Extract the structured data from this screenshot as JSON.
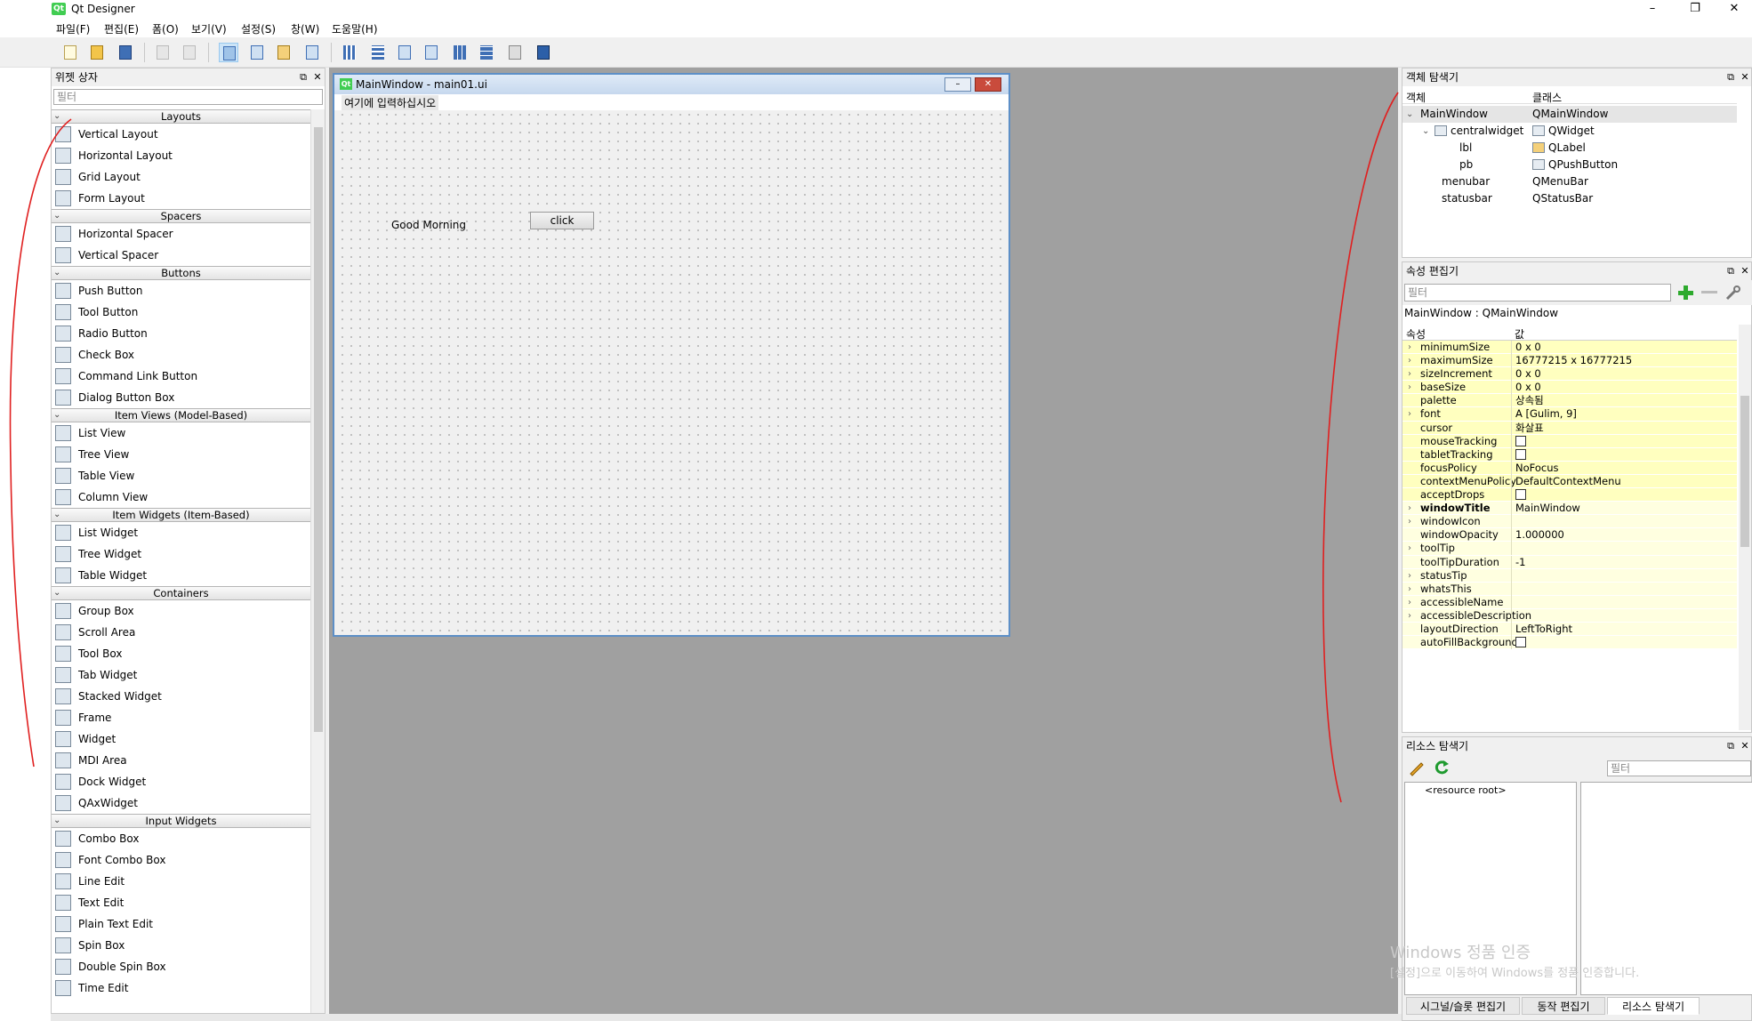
{
  "window": {
    "title": "Qt Designer",
    "logo": "Qt",
    "controls": [
      "–",
      "❐",
      "✕"
    ]
  },
  "menus": [
    "파일(F)",
    "편집(E)",
    "폼(O)",
    "보기(V)",
    "설정(S)",
    "창(W)",
    "도움말(H)"
  ],
  "toolbar_icons": [
    "new-file-icon",
    "open-folder-icon",
    "save-icon",
    "cut-icon",
    "copy-icon",
    "edit-widgets-icon",
    "edit-signals-icon",
    "edit-buddies-icon",
    "edit-taborder-icon",
    "layout-horizontal-icon",
    "layout-vertical-icon",
    "layout-hsplitter-icon",
    "layout-vsplitter-icon",
    "layout-grid-icon",
    "layout-form-icon",
    "break-layout-icon",
    "adjust-size-icon"
  ],
  "widget_box": {
    "title": "위젯 상자",
    "filter_placeholder": "필터",
    "categories": [
      {
        "name": "Layouts",
        "items": [
          "Vertical Layout",
          "Horizontal Layout",
          "Grid Layout",
          "Form Layout"
        ]
      },
      {
        "name": "Spacers",
        "items": [
          "Horizontal Spacer",
          "Vertical Spacer"
        ]
      },
      {
        "name": "Buttons",
        "items": [
          "Push Button",
          "Tool Button",
          "Radio Button",
          "Check Box",
          "Command Link Button",
          "Dialog Button Box"
        ]
      },
      {
        "name": "Item Views (Model-Based)",
        "items": [
          "List View",
          "Tree View",
          "Table View",
          "Column View"
        ]
      },
      {
        "name": "Item Widgets (Item-Based)",
        "items": [
          "List Widget",
          "Tree Widget",
          "Table Widget"
        ]
      },
      {
        "name": "Containers",
        "items": [
          "Group Box",
          "Scroll Area",
          "Tool Box",
          "Tab Widget",
          "Stacked Widget",
          "Frame",
          "Widget",
          "MDI Area",
          "Dock Widget",
          "QAxWidget"
        ]
      },
      {
        "name": "Input Widgets",
        "items": [
          "Combo Box",
          "Font Combo Box",
          "Line Edit",
          "Text Edit",
          "Plain Text Edit",
          "Spin Box",
          "Double Spin Box",
          "Time Edit"
        ]
      }
    ]
  },
  "form_window": {
    "title": "MainWindow - main01.ui",
    "menu_placeholder": "여기에 입력하십시오",
    "label_text": "Good Morning",
    "button_text": "click"
  },
  "object_inspector": {
    "title": "객체 탐색기",
    "col_object": "객체",
    "col_class": "클래스",
    "rows": [
      {
        "name": "MainWindow",
        "class": "QMainWindow"
      },
      {
        "name": "centralwidget",
        "class": "QWidget"
      },
      {
        "name": "lbl",
        "class": "QLabel"
      },
      {
        "name": "pb",
        "class": "QPushButton"
      },
      {
        "name": "menubar",
        "class": "QMenuBar"
      },
      {
        "name": "statusbar",
        "class": "QStatusBar"
      }
    ]
  },
  "property_editor": {
    "title": "속성 편집기",
    "filter_placeholder": "필터",
    "object_line": "MainWindow : QMainWindow",
    "col_property": "속성",
    "col_value": "값",
    "rows": [
      {
        "name": "minimumSize",
        "value": "0 x 0"
      },
      {
        "name": "maximumSize",
        "value": "16777215 x 16777215"
      },
      {
        "name": "sizeIncrement",
        "value": "0 x 0"
      },
      {
        "name": "baseSize",
        "value": "0 x 0"
      },
      {
        "name": "palette",
        "value": "상속됨"
      },
      {
        "name": "font",
        "value": "A  [Gulim, 9]"
      },
      {
        "name": "cursor",
        "value": "화살표"
      },
      {
        "name": "mouseTracking",
        "value": ""
      },
      {
        "name": "tabletTracking",
        "value": ""
      },
      {
        "name": "focusPolicy",
        "value": "NoFocus"
      },
      {
        "name": "contextMenuPolicy",
        "value": "DefaultContextMenu"
      },
      {
        "name": "acceptDrops",
        "value": ""
      },
      {
        "name": "windowTitle",
        "value": "MainWindow"
      },
      {
        "name": "windowIcon",
        "value": ""
      },
      {
        "name": "windowOpacity",
        "value": "1.000000"
      },
      {
        "name": "toolTip",
        "value": ""
      },
      {
        "name": "toolTipDuration",
        "value": "-1"
      },
      {
        "name": "statusTip",
        "value": ""
      },
      {
        "name": "whatsThis",
        "value": ""
      },
      {
        "name": "accessibleName",
        "value": ""
      },
      {
        "name": "accessibleDescription",
        "value": ""
      },
      {
        "name": "layoutDirection",
        "value": "LeftToRight"
      },
      {
        "name": "autoFillBackground",
        "value": ""
      }
    ]
  },
  "resource_browser": {
    "title": "리소스 탐색기",
    "filter_placeholder": "필터",
    "root_item": "<resource root>"
  },
  "watermark": {
    "line1": "Windows 정품 인증",
    "line2": "[설정]으로 이동하여 Windows를 정품 인증합니다."
  },
  "bottom_tabs": [
    "시그널/슬롯 편집기",
    "동작 편집기",
    "리소스 탐색기"
  ],
  "colors": {
    "qt_green": "#41cd52",
    "property_yellow": "#ffffbf",
    "mdi_gray": "#a0a0a0",
    "ink_red": "#e02020"
  }
}
